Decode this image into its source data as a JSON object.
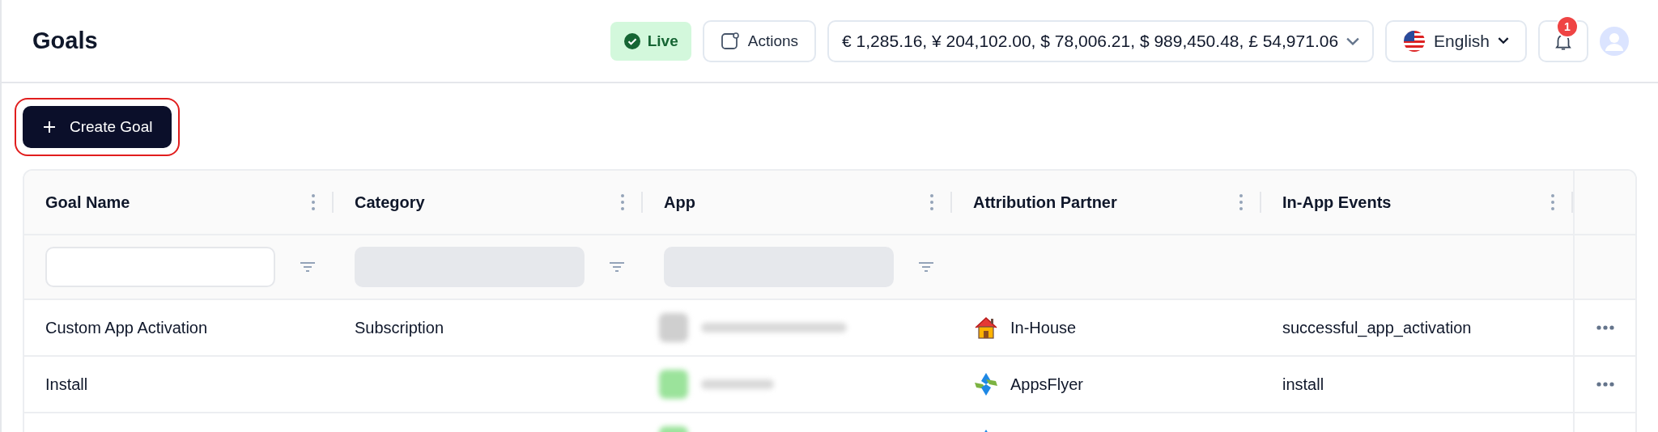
{
  "header": {
    "title": "Goals",
    "live": {
      "label": "Live"
    },
    "actions": {
      "label": "Actions"
    },
    "balance": {
      "value": "€ 1,285.16, ¥ 204,102.00, $ 78,006.21, $ 989,450.48, £ 54,971.06"
    },
    "language": {
      "label": "English"
    },
    "notifications": {
      "badge": "1"
    }
  },
  "create_button": {
    "label": "Create Goal",
    "highlighted": true
  },
  "table": {
    "columns": [
      {
        "label": "Goal Name",
        "filter": {
          "kind": "input",
          "disabled": false
        }
      },
      {
        "label": "Category",
        "filter": {
          "kind": "input",
          "disabled": true
        }
      },
      {
        "label": "App",
        "filter": {
          "kind": "input",
          "disabled": true
        }
      },
      {
        "label": "Attribution Partner"
      },
      {
        "label": "In-App Events"
      }
    ],
    "rows": [
      {
        "goal": "Custom App Activation",
        "category": "Subscription",
        "app": {
          "kind": "blurred",
          "color": "#cfcfcf"
        },
        "partner": {
          "kind": "house",
          "name": "In-House"
        },
        "event": "successful_app_activation"
      },
      {
        "goal": "Install",
        "app": {
          "kind": "blurred",
          "color": "#9be39b"
        },
        "partner": {
          "kind": "appsflyer",
          "name": "AppsFlyer"
        },
        "event": "install"
      },
      {
        "app": {
          "kind": "blurred_icon",
          "color": "#9be39b"
        },
        "partner": {
          "kind": "appsflyer"
        }
      }
    ]
  }
}
